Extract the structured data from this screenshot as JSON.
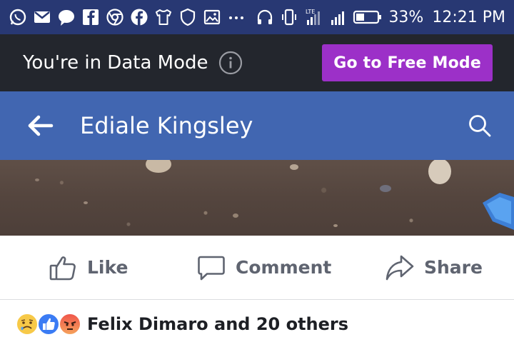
{
  "status_bar": {
    "battery_percent": "33%",
    "time": "12:21 PM",
    "network_badge": "LTE",
    "left_icons": [
      "whatsapp-icon",
      "gmail-icon",
      "messenger-icon",
      "facebook-lite-icon",
      "chrome-icon",
      "facebook-icon",
      "tshirt-icon",
      "shield-icon",
      "image-icon",
      "more-dots-icon"
    ],
    "right_icons": [
      "headset-icon",
      "vibrate-icon",
      "lte-signal-icon",
      "signal-icon",
      "battery-icon"
    ],
    "background": "#283873"
  },
  "data_mode": {
    "message": "You're in Data Mode",
    "button_label": "Go to Free Mode",
    "button_color": "#9c30c8",
    "background": "#23262d"
  },
  "header": {
    "title": "Ediale Kingsley",
    "background": "#4166b1"
  },
  "post_actions": {
    "like_label": "Like",
    "comment_label": "Comment",
    "share_label": "Share"
  },
  "reactions": {
    "types": [
      "sad",
      "like",
      "angry"
    ],
    "summary": "Felix Dimaro and 20 others"
  }
}
